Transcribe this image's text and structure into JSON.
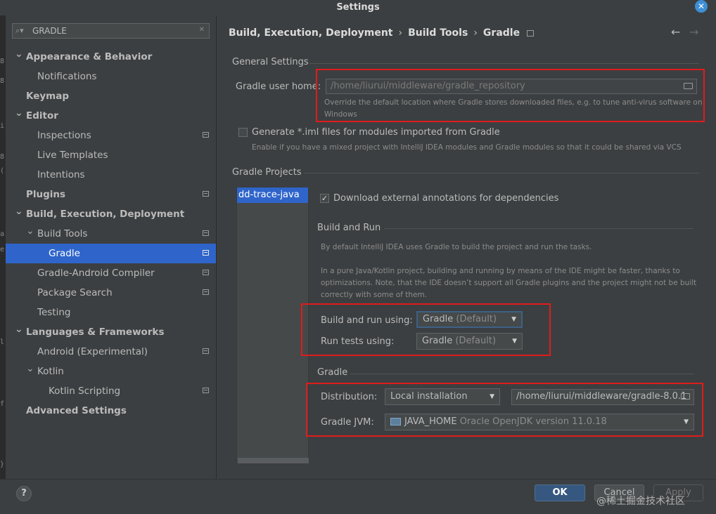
{
  "window": {
    "title": "Settings"
  },
  "colors": {
    "accent": "#2f65ca",
    "annotation": "#e01b1b",
    "ok_button": "#365880"
  },
  "gutter_glyphs": [
    "8",
    "8",
    "i",
    "8",
    "(",
    "a",
    "e",
    "l",
    "f",
    "}"
  ],
  "sidebar": {
    "search": {
      "value": "GRADLE",
      "icon": "search-icon"
    },
    "items": [
      {
        "label": "Appearance & Behavior",
        "level": 0,
        "bold": true,
        "expander": "expanded"
      },
      {
        "label": "Notifications",
        "level": 1,
        "bold": false
      },
      {
        "label": "Keymap",
        "level": 0,
        "bold": true
      },
      {
        "label": "Editor",
        "level": 0,
        "bold": true,
        "expander": "expanded"
      },
      {
        "label": "Inspections",
        "level": 1,
        "bold": false,
        "page_icon": true
      },
      {
        "label": "Live Templates",
        "level": 1,
        "bold": false
      },
      {
        "label": "Intentions",
        "level": 1,
        "bold": false
      },
      {
        "label": "Plugins",
        "level": 0,
        "bold": true,
        "page_icon": true
      },
      {
        "label": "Build, Execution, Deployment",
        "level": 0,
        "bold": true,
        "expander": "expanded"
      },
      {
        "label": "Build Tools",
        "level": 1,
        "bold": false,
        "expander": "expanded",
        "page_icon": true
      },
      {
        "label": "Gradle",
        "level": 2,
        "bold": false,
        "selected": true,
        "page_icon": true
      },
      {
        "label": "Gradle-Android Compiler",
        "level": 1,
        "bold": false,
        "page_icon": true
      },
      {
        "label": "Package Search",
        "level": 1,
        "bold": false,
        "page_icon": true
      },
      {
        "label": "Testing",
        "level": 1,
        "bold": false
      },
      {
        "label": "Languages & Frameworks",
        "level": 0,
        "bold": true,
        "expander": "expanded"
      },
      {
        "label": "Android (Experimental)",
        "level": 1,
        "bold": false,
        "page_icon": true
      },
      {
        "label": "Kotlin",
        "level": 1,
        "bold": false,
        "expander": "expanded"
      },
      {
        "label": "Kotlin Scripting",
        "level": 2,
        "bold": false,
        "page_icon": true
      },
      {
        "label": "Advanced Settings",
        "level": 0,
        "bold": true
      }
    ]
  },
  "breadcrumb": {
    "items": [
      "Build, Execution, Deployment",
      "Build Tools",
      "Gradle"
    ],
    "separator": "›"
  },
  "nav": {
    "back": "←",
    "forward": "→"
  },
  "general": {
    "section_title": "General Settings",
    "user_home_label": "Gradle user home:",
    "user_home_value": "/home/liurui/middleware/gradle_repository",
    "user_home_hint_1": "Override the default location where Gradle stores downloaded files, e.g. to tune anti-virus software on",
    "user_home_hint_2": "Windows",
    "iml_label": "Generate *.iml files for modules imported from Gradle",
    "iml_checked": false,
    "iml_hint": "Enable if you have a mixed project with IntelliJ IDEA modules and Gradle modules so that it could be shared via VCS"
  },
  "projects": {
    "section_title": "Gradle Projects",
    "list": [
      "dd-trace-java"
    ],
    "download_annotations_label": "Download external annotations for dependencies",
    "download_annotations_checked": true,
    "check_mark": "✓"
  },
  "build_run": {
    "section_title": "Build and Run",
    "hint_1": "By default IntelliJ IDEA uses Gradle to build the project and run the tasks.",
    "hint_2": "In a pure Java/Kotlin project, building and running by means of the IDE might be faster, thanks to",
    "hint_3": "optimizations. Note, that the IDE doesn’t support all Gradle plugins and the project might not be built",
    "hint_4": "correctly with some of them.",
    "build_label": "Build and run using:",
    "build_value": "Gradle",
    "build_suffix": "(Default)",
    "tests_label": "Run tests using:",
    "tests_value": "Gradle",
    "tests_suffix": "(Default)"
  },
  "gradle": {
    "section_title": "Gradle",
    "distribution_label": "Distribution:",
    "distribution_value": "Local installation",
    "distribution_path": "/home/liurui/middleware/gradle-8.0.1",
    "jvm_label": "Gradle JVM:",
    "jvm_name": "JAVA_HOME",
    "jvm_detail": "Oracle OpenJDK version 11.0.18"
  },
  "footer": {
    "help": "?",
    "ok": "OK",
    "cancel": "Cancel",
    "apply": "Apply",
    "watermark": "@稀土掘金技术社区"
  }
}
